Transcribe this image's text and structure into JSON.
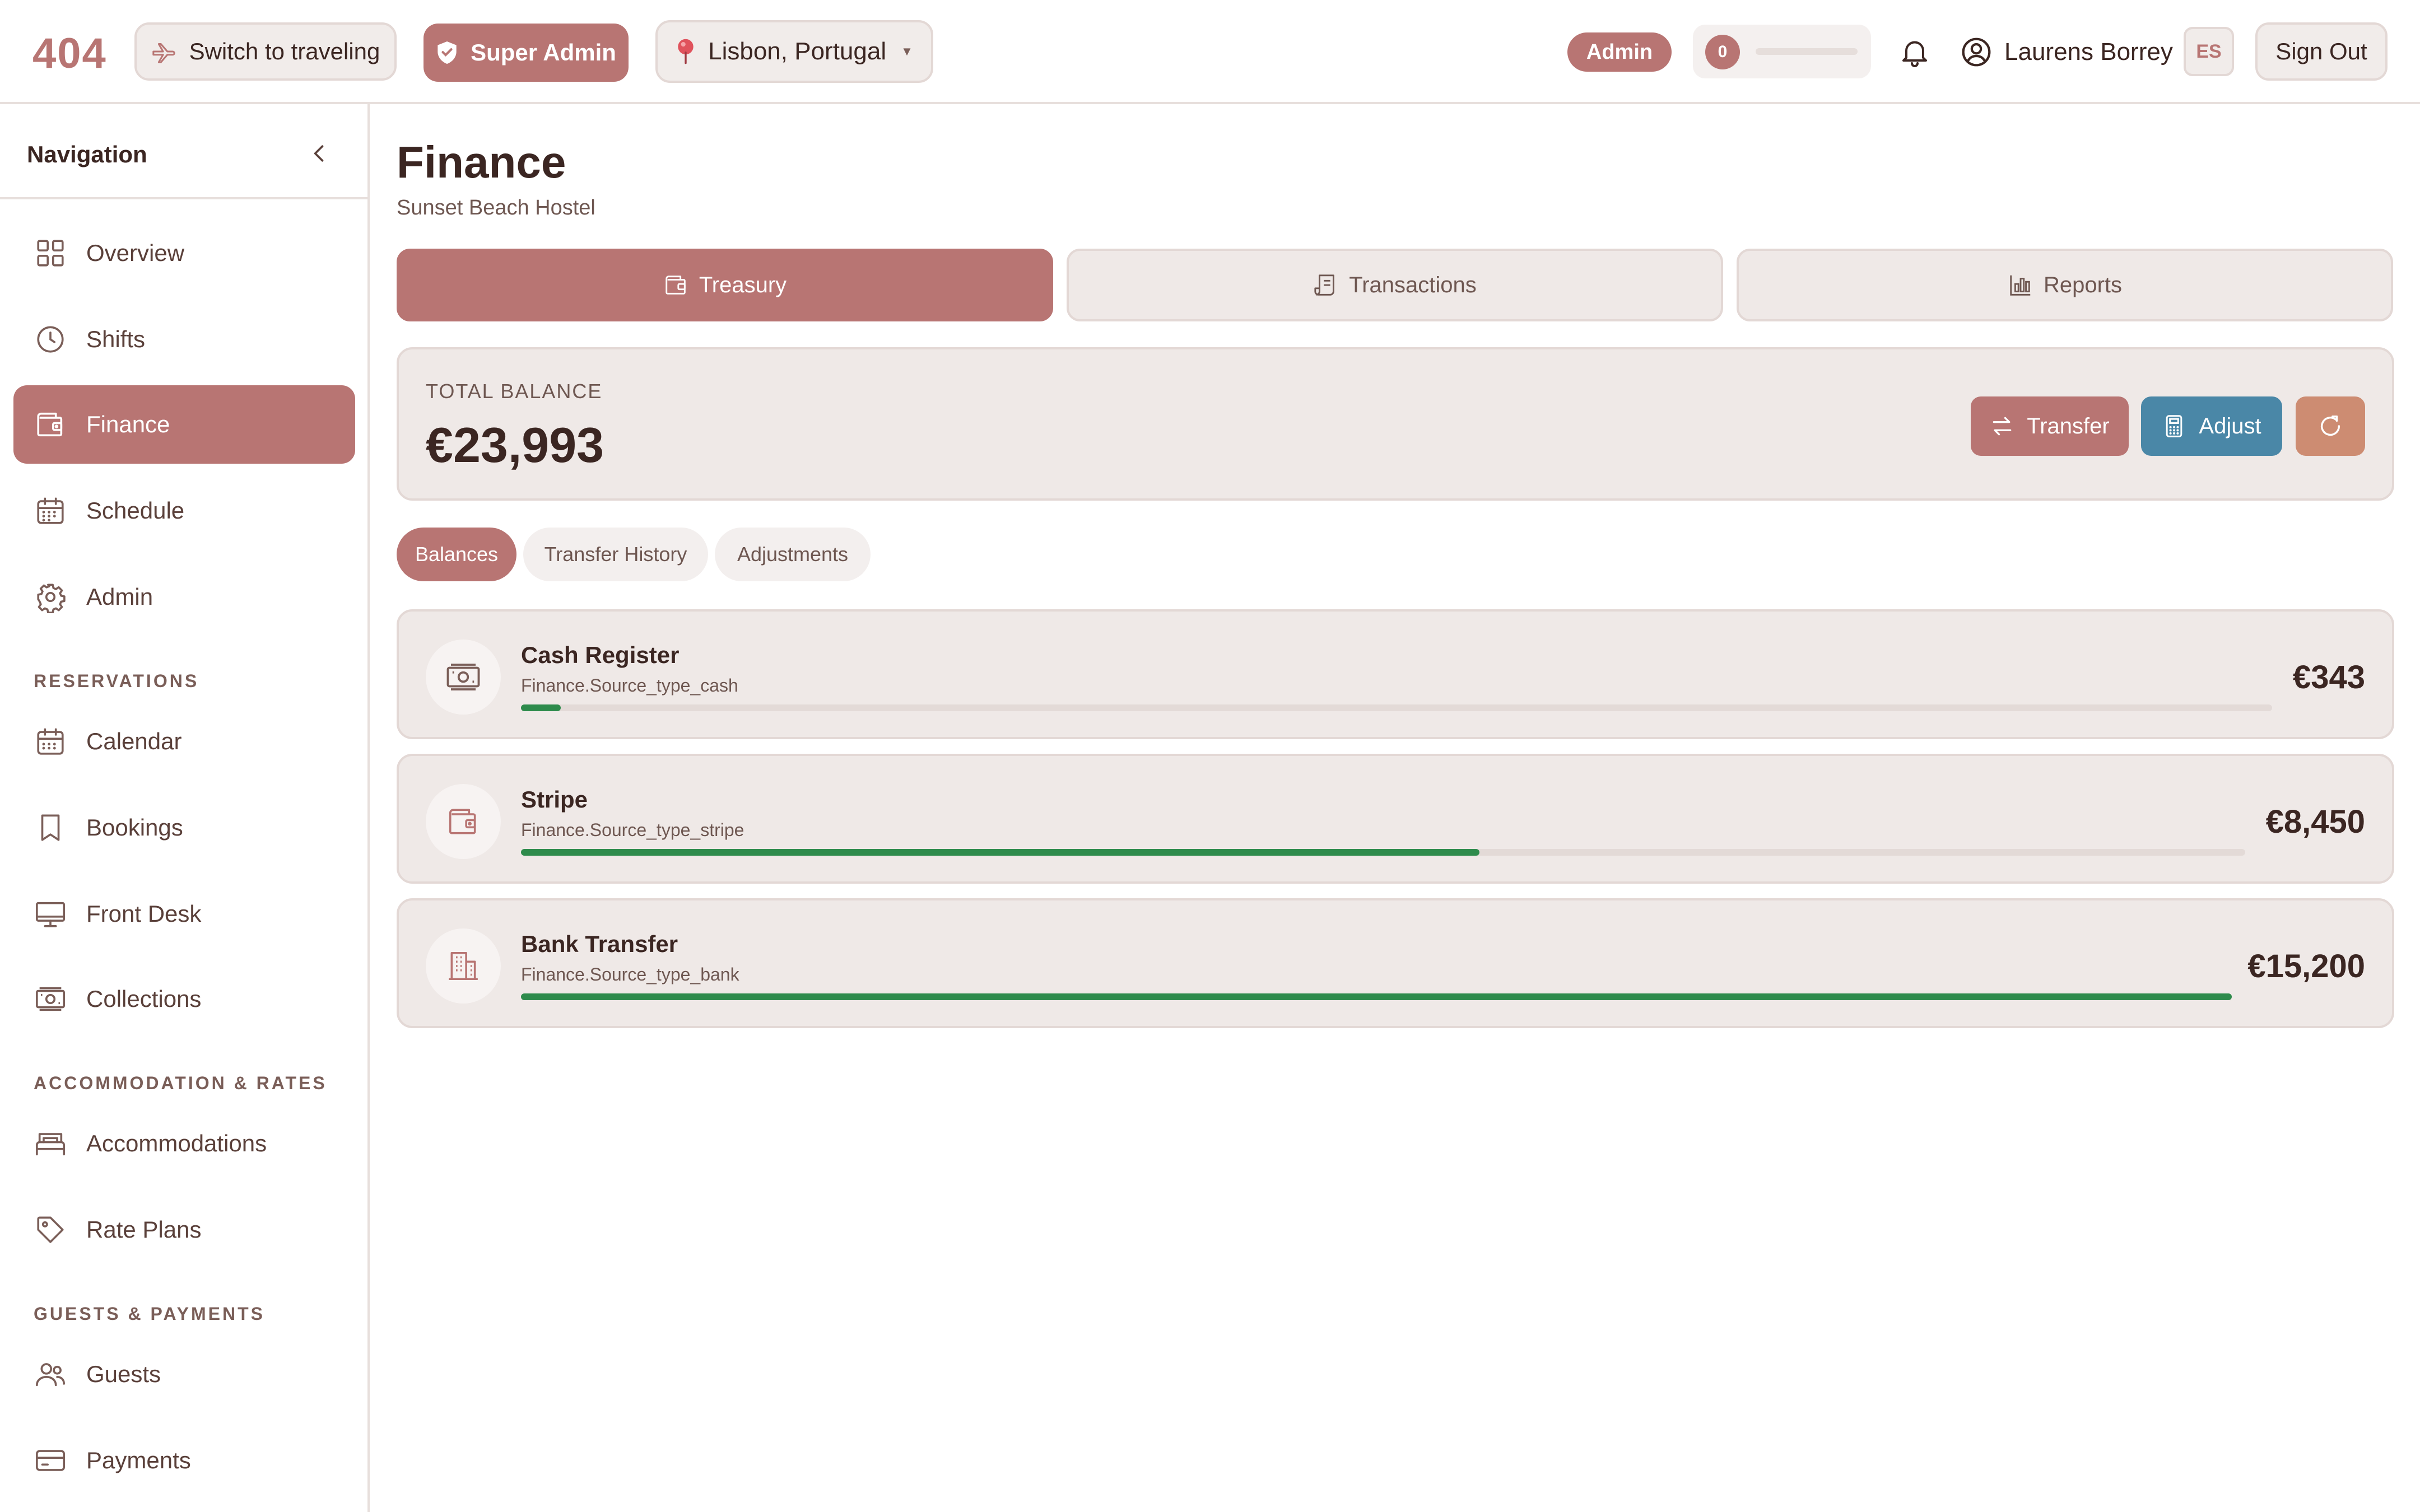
{
  "topbar": {
    "logo": "404",
    "travel_label": "Switch to traveling",
    "super_admin_label": "Super Admin",
    "location": "Lisbon, Portugal",
    "admin_badge": "Admin",
    "task_count": "0",
    "task_progress": 0,
    "user_name": "Laurens Borrey",
    "lang": "ES",
    "sign_out": "Sign Out"
  },
  "sidebar": {
    "title": "Navigation",
    "items": [
      {
        "label": "Overview",
        "icon": "grid-icon"
      },
      {
        "label": "Shifts",
        "icon": "clock-icon"
      },
      {
        "label": "Finance",
        "icon": "wallet-icon",
        "active": true
      },
      {
        "label": "Schedule",
        "icon": "calendar-grid-icon"
      },
      {
        "label": "Admin",
        "icon": "gear-icon"
      }
    ],
    "sections": [
      {
        "title": "RESERVATIONS",
        "items": [
          {
            "label": "Calendar",
            "icon": "calendar-icon"
          },
          {
            "label": "Bookings",
            "icon": "bookmark-icon"
          },
          {
            "label": "Front Desk",
            "icon": "monitor-icon"
          },
          {
            "label": "Collections",
            "icon": "cash-icon"
          }
        ]
      },
      {
        "title": "ACCOMMODATION & RATES",
        "items": [
          {
            "label": "Accommodations",
            "icon": "bed-icon"
          },
          {
            "label": "Rate Plans",
            "icon": "tag-icon"
          }
        ]
      },
      {
        "title": "GUESTS & PAYMENTS",
        "items": [
          {
            "label": "Guests",
            "icon": "users-icon"
          },
          {
            "label": "Payments",
            "icon": "credit-card-icon"
          }
        ]
      }
    ]
  },
  "main": {
    "title": "Finance",
    "subtitle": "Sunset Beach Hostel",
    "tabs": [
      {
        "label": "Treasury",
        "icon": "wallet-icon",
        "active": true
      },
      {
        "label": "Transactions",
        "icon": "receipt-icon"
      },
      {
        "label": "Reports",
        "icon": "bar-chart-icon"
      }
    ],
    "balance": {
      "label": "TOTAL BALANCE",
      "value": "€23,993",
      "transfer_label": "Transfer",
      "adjust_label": "Adjust"
    },
    "subtabs": [
      {
        "label": "Balances",
        "active": true
      },
      {
        "label": "Transfer History"
      },
      {
        "label": "Adjustments"
      }
    ],
    "sources": [
      {
        "name": "Cash Register",
        "type": "Finance.Source_type_cash",
        "amount": "€343",
        "share": 0.0226,
        "icon": "cash-icon"
      },
      {
        "name": "Stripe",
        "type": "Finance.Source_type_stripe",
        "amount": "€8,450",
        "share": 0.556,
        "icon": "wallet-icon"
      },
      {
        "name": "Bank Transfer",
        "type": "Finance.Source_type_bank",
        "amount": "€15,200",
        "share": 1.0,
        "icon": "building-icon"
      }
    ]
  },
  "colors": {
    "accent": "#b87573",
    "adjust": "#4a87a7",
    "refresh": "#cd8c72",
    "progress": "#2e8b4c"
  }
}
